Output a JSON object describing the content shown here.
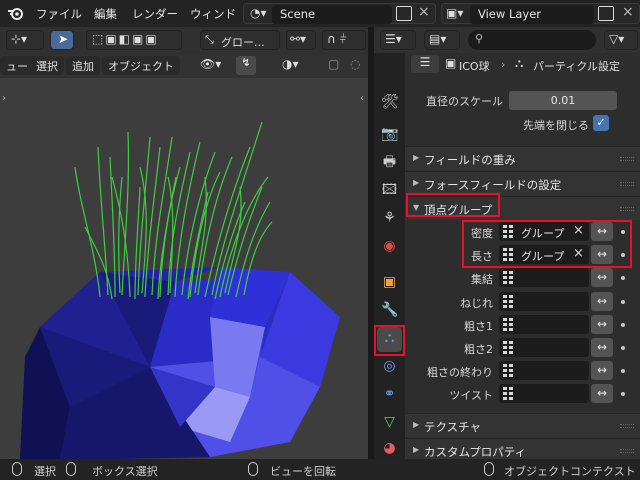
{
  "topbar": {
    "menus": [
      "ファイル",
      "編集",
      "レンダー",
      "ウィンド"
    ],
    "scene": "Scene",
    "view_layer": "View Layer"
  },
  "viewport": {
    "transform_orientation": "グロー...",
    "mode_buttons": [
      "ュー",
      "選択",
      "追加",
      "オブジェクト"
    ]
  },
  "properties": {
    "breadcrumb": {
      "object": "ICO球",
      "section": "パーティクル設定"
    },
    "top_rows": [
      {
        "label": "直径のスケール",
        "value": "0.01"
      },
      {
        "label": "先端を閉じる",
        "checked": true
      }
    ],
    "panels": {
      "field_weights": "フィールドの重み",
      "force_field": "フォースフィールドの設定",
      "vertex_groups": "頂点グループ",
      "textures": "テクスチャ",
      "custom_props": "カスタムプロパティ"
    },
    "vertex_rows": [
      {
        "label": "密度",
        "value": "グループ"
      },
      {
        "label": "長さ",
        "value": "グループ"
      },
      {
        "label": "集結",
        "value": ""
      },
      {
        "label": "ねじれ",
        "value": ""
      },
      {
        "label": "粗さ1",
        "value": ""
      },
      {
        "label": "粗さ2",
        "value": ""
      },
      {
        "label": "粗さの終わり",
        "value": ""
      },
      {
        "label": "ツイスト",
        "value": ""
      }
    ],
    "swap_symbol": "↔",
    "clear_symbol": "×"
  },
  "status": {
    "select": "選択",
    "box_select": "ボックス選択",
    "rotate_view": "ビューを回転",
    "object_context": "オブジェクトコンテクスト"
  },
  "colors": {
    "highlight": "#e8102a",
    "accent_blue": "#4772b3",
    "sphere": "#2b2bd0",
    "hair": "#3fd63f"
  }
}
